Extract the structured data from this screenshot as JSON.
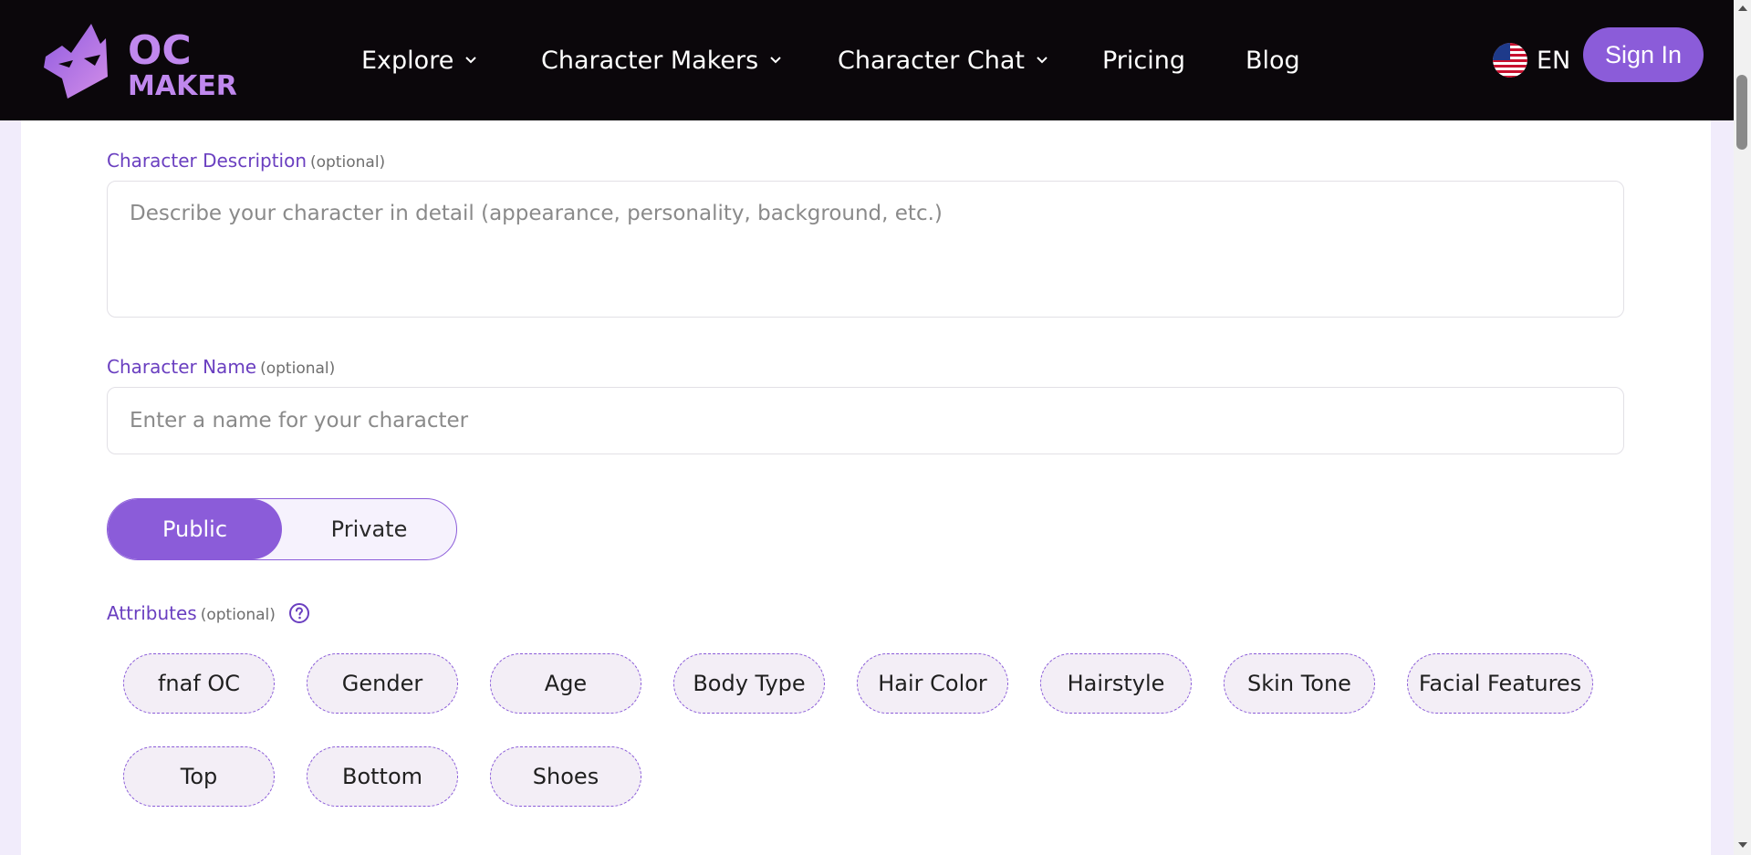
{
  "header": {
    "logo_alt": "OC MAKER",
    "nav": [
      {
        "label": "Explore",
        "has_dropdown": true
      },
      {
        "label": "Character Makers",
        "has_dropdown": true
      },
      {
        "label": "Character Chat",
        "has_dropdown": true
      },
      {
        "label": "Pricing",
        "has_dropdown": false
      },
      {
        "label": "Blog",
        "has_dropdown": false
      }
    ],
    "language": "EN",
    "sign_in": "Sign In"
  },
  "form": {
    "description": {
      "label": "Character Description",
      "optional": "(optional)",
      "placeholder": "Describe your character in detail (appearance, personality, background, etc.)"
    },
    "name": {
      "label": "Character Name",
      "optional": "(optional)",
      "placeholder": "Enter a name for your character"
    },
    "visibility": {
      "options": [
        "Public",
        "Private"
      ],
      "selected": "Public"
    },
    "attributes": {
      "label": "Attributes",
      "optional": "(optional)",
      "chips": [
        "fnaf OC",
        "Gender",
        "Age",
        "Body Type",
        "Hair Color",
        "Hairstyle",
        "Skin Tone",
        "Facial Features",
        "Top",
        "Bottom",
        "Shoes"
      ]
    }
  },
  "colors": {
    "accent": "#8b5cd9",
    "label": "#6a3fc0",
    "header_bg": "#0b070b"
  },
  "icons": {
    "logo": "oc-maker-logo",
    "flag": "us-flag-icon",
    "help": "question-circle-icon",
    "chevron": "chevron-down-icon"
  }
}
